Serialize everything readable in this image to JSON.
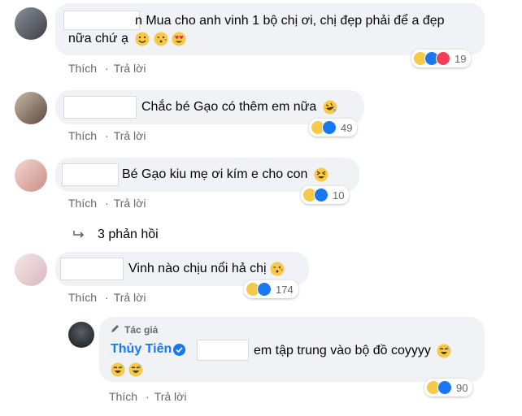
{
  "comments": [
    {
      "text": "n Mua cho anh vinh 1 bộ chị ơi, chị đẹp phải để a đẹp",
      "text2": "nữa chứ ạ",
      "reaction_count": "19"
    },
    {
      "text": "Chắc bé Gạo có thêm em nữa",
      "reaction_count": "49"
    },
    {
      "text": "Bé Gạo kiu mẹ ơi kím e cho con",
      "reaction_count": "10"
    },
    {
      "text": "Vinh nào chịu nổi hả chị",
      "reaction_count": "174"
    }
  ],
  "actions": {
    "like": "Thích",
    "reply": "Trả lời"
  },
  "replies_link": "3 phản hồi",
  "author_reply": {
    "badge": "Tác giả",
    "name": "Thủy Tiên",
    "text": "em tập trung vào bộ đồ coyyyy",
    "reaction_count": "90"
  },
  "colors": {
    "bubble": "#f0f2f5",
    "link": "#1877f2",
    "muted": "#65676b"
  }
}
